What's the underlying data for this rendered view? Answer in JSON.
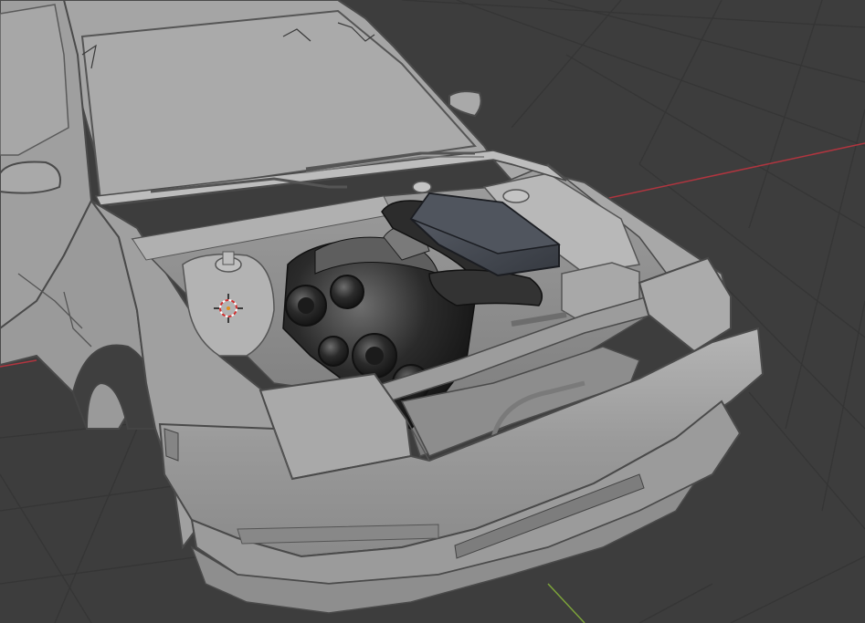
{
  "viewport": {
    "background": "#3d3d3d",
    "grid_color": "#353535",
    "x_axis_color": "#b0353f",
    "y_axis_color": "#7da43a"
  },
  "scene": {
    "objects": [
      {
        "name": "car-body",
        "material": "solid-grey",
        "color": "#a3a3a3"
      },
      {
        "name": "engine",
        "material": "dark-metal",
        "color": "#2a2a2a"
      },
      {
        "name": "air-intake-box",
        "material": "dark-blue-grey",
        "color": "#42474f"
      }
    ],
    "gizmo": {
      "name": "3d-cursor"
    }
  }
}
